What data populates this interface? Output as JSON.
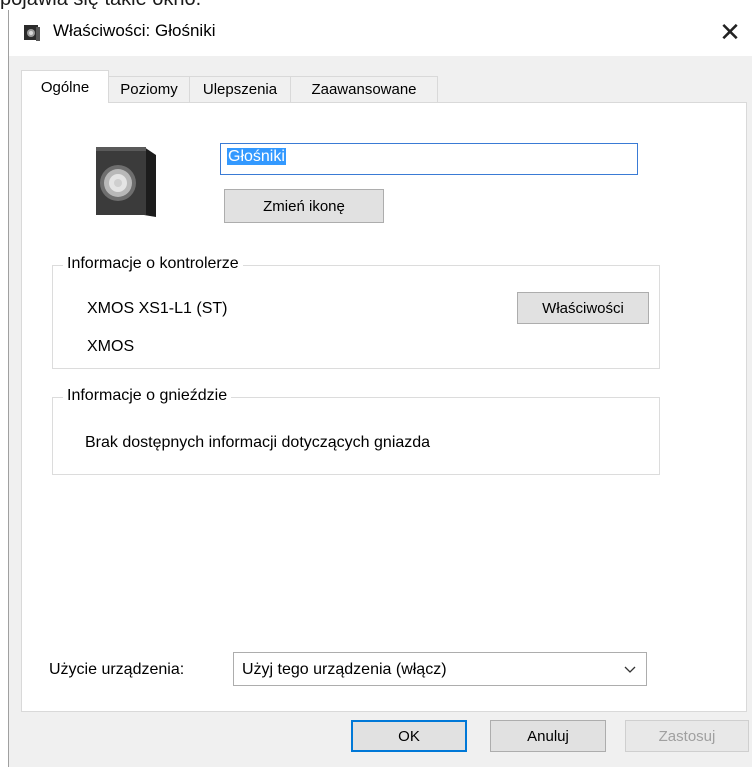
{
  "caption_fragment": "pojawia się takie okno.",
  "window": {
    "title": "Właściwości: Głośniki",
    "close_glyph": "✕"
  },
  "tabs": [
    {
      "label": "Ogólne",
      "active": true
    },
    {
      "label": "Poziomy",
      "active": false
    },
    {
      "label": "Ulepszenia",
      "active": false
    },
    {
      "label": "Zaawansowane",
      "active": false
    }
  ],
  "general": {
    "device_name": "Głośniki",
    "change_icon_label": "Zmień ikonę",
    "controller_group": {
      "label": "Informacje o kontrolerze",
      "controller_name": "XMOS XS1-L1 (ST)",
      "manufacturer": "XMOS",
      "properties_button": "Właściwości"
    },
    "jack_group": {
      "label": "Informacje o gnieździe",
      "info": "Brak dostępnych informacji dotyczących gniazda"
    },
    "device_usage": {
      "label": "Użycie urządzenia:",
      "selected": "Użyj tego urządzenia (włącz)"
    }
  },
  "footer": {
    "ok": "OK",
    "cancel": "Anuluj",
    "apply": "Zastosuj"
  },
  "colors": {
    "accent": "#3399ff",
    "window_bg": "#f0f0f0",
    "disabled_text": "#a0a0a0"
  },
  "icons": [
    "speaker-icon",
    "close-icon",
    "chevron-down-icon"
  ]
}
